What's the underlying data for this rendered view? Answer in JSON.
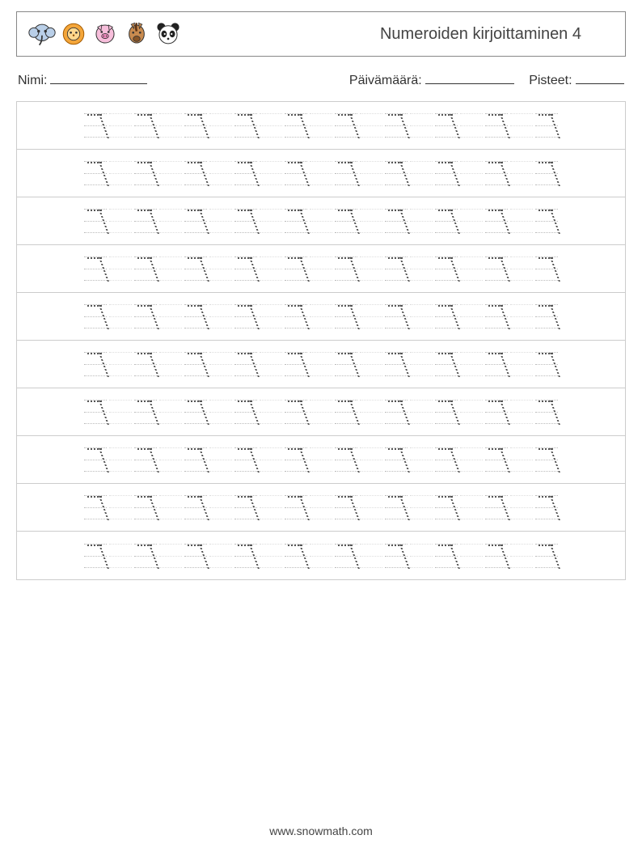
{
  "header": {
    "title": "Numeroiden kirjoittaminen 4",
    "icons": [
      "elephant",
      "lion",
      "pig",
      "horse",
      "panda"
    ]
  },
  "meta": {
    "name_label": "Nimi:",
    "date_label": "Päivämäärä:",
    "score_label": "Pisteet:"
  },
  "practice": {
    "digit": "7",
    "rows": 10,
    "digits_per_row": 10
  },
  "footer": {
    "url": "www.snowmath.com"
  }
}
